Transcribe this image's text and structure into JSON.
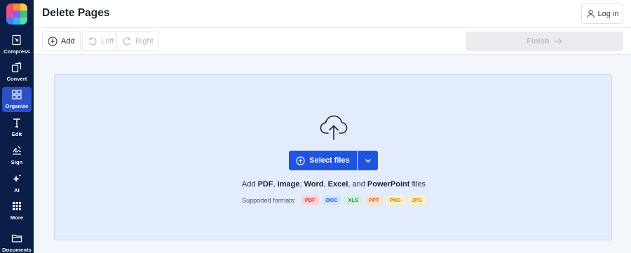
{
  "app": {
    "title": "Delete Pages"
  },
  "header": {
    "login_label": "Log in"
  },
  "sidebar": {
    "items": [
      {
        "label": "Compress",
        "icon": "compress-icon"
      },
      {
        "label": "Convert",
        "icon": "convert-icon"
      },
      {
        "label": "Organize",
        "icon": "organize-icon",
        "active": true
      },
      {
        "label": "Edit",
        "icon": "text-edit-icon"
      },
      {
        "label": "Sign",
        "icon": "signature-icon"
      },
      {
        "label": "AI",
        "icon": "sparkle-icon"
      },
      {
        "label": "More",
        "icon": "grid-dots-icon"
      },
      {
        "label": "Documents",
        "icon": "folder-icon"
      }
    ]
  },
  "toolbar": {
    "add_label": "Add",
    "left_label": "Left",
    "right_label": "Right",
    "finish_label": "Finish"
  },
  "dropzone": {
    "select_files_label": "Select files",
    "add_text_prefix": "Add",
    "add_text_items": [
      "PDF",
      "image",
      "Word",
      "Excel",
      "PowerPoint"
    ],
    "add_text_suffix": "files",
    "supported_label": "Supported formats:",
    "formats": [
      {
        "label": "PDF",
        "bg": "#fbd3d6",
        "fg": "#d2343f"
      },
      {
        "label": "DOC",
        "bg": "#d3e2fb",
        "fg": "#2457c5"
      },
      {
        "label": "XLS",
        "bg": "#d2f0dc",
        "fg": "#1d8a46"
      },
      {
        "label": "PPT",
        "bg": "#fde0cc",
        "fg": "#d2601c"
      },
      {
        "label": "PNG",
        "bg": "#fdf0c2",
        "fg": "#b98a08"
      },
      {
        "label": "JPG",
        "bg": "#fdf0c2",
        "fg": "#b98a08"
      }
    ]
  },
  "colors": {
    "sidebar_bg": "#0c1d47",
    "sidebar_active": "#2b4fc4",
    "primary": "#1f54e0",
    "dropzone_bg": "#e3ecfb",
    "logo": [
      "#f2545b",
      "#f78c3b",
      "#f7c948",
      "#e94ba0",
      "#8e5cf0",
      "#3fc37b",
      "#4b7cf3",
      "#29b6e8",
      "#5cd6b0"
    ]
  }
}
